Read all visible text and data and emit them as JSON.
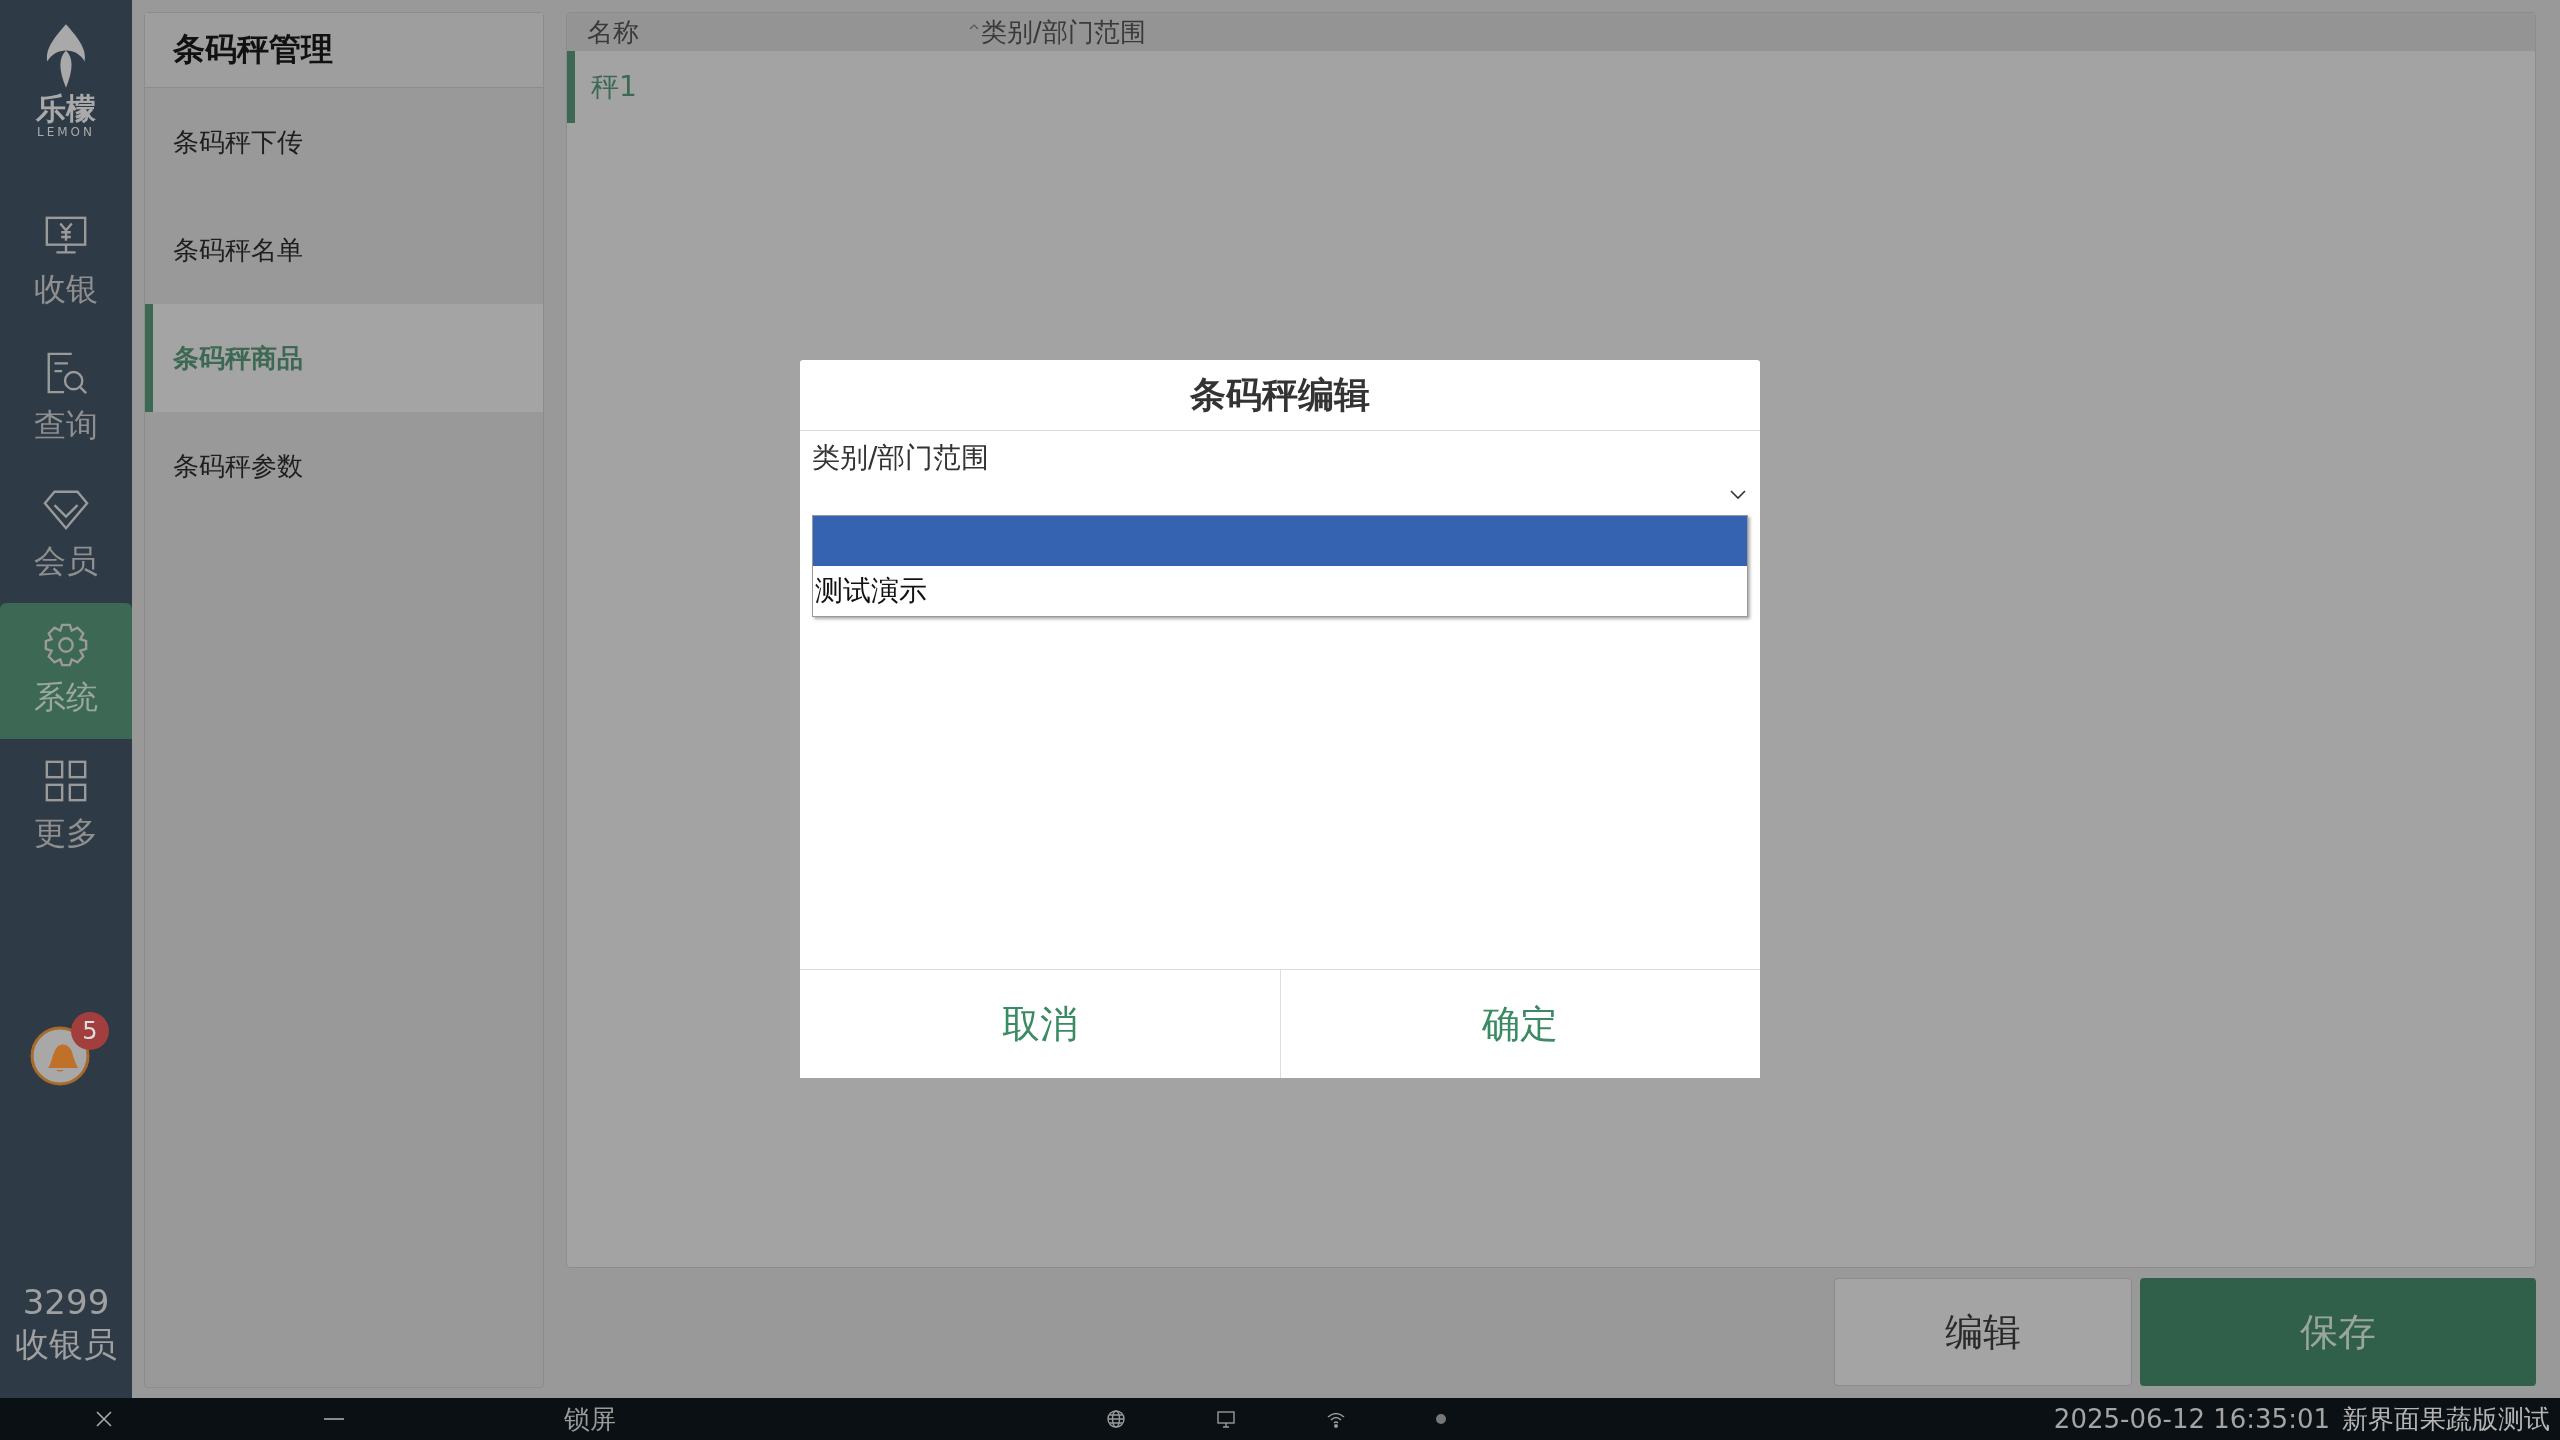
{
  "app": {
    "logo_text": "乐檬",
    "logo_subtext": "LEMON"
  },
  "nav": [
    {
      "label": "收银",
      "kind": "register",
      "selected": false
    },
    {
      "label": "查询",
      "kind": "search",
      "selected": false
    },
    {
      "label": "会员",
      "kind": "diamond",
      "selected": false
    },
    {
      "label": "系统",
      "kind": "gear",
      "selected": true
    },
    {
      "label": "更多",
      "kind": "grid",
      "selected": false
    }
  ],
  "notifications": {
    "count": "5"
  },
  "user": {
    "id": "3299",
    "role": "收银员"
  },
  "menu": {
    "title": "条码秤管理",
    "items": [
      {
        "label": "条码秤下传",
        "selected": false
      },
      {
        "label": "条码秤名单",
        "selected": false
      },
      {
        "label": "条码秤商品",
        "selected": true
      },
      {
        "label": "条码秤参数",
        "selected": false
      }
    ]
  },
  "table": {
    "columns": [
      "名称",
      "类别/部门范围"
    ],
    "rows": [
      {
        "name": "秤1",
        "selected": true
      }
    ]
  },
  "actions": [
    {
      "label": "编辑",
      "kind": "secondary"
    },
    {
      "label": "保存",
      "kind": "primary"
    }
  ],
  "dialog": {
    "title": "条码秤编辑",
    "field_label": "类别/部门范围",
    "dropdown": {
      "expanded": true,
      "options": [
        {
          "selected": true
        },
        {
          "label": "测试演示",
          "selected": false
        }
      ]
    },
    "buttons": [
      "取消",
      "确定"
    ]
  },
  "status_bar": {
    "lock_label": "锁屏",
    "datetime": "2025-06-12 16:35:01",
    "store": "新界面果蔬版测试"
  }
}
